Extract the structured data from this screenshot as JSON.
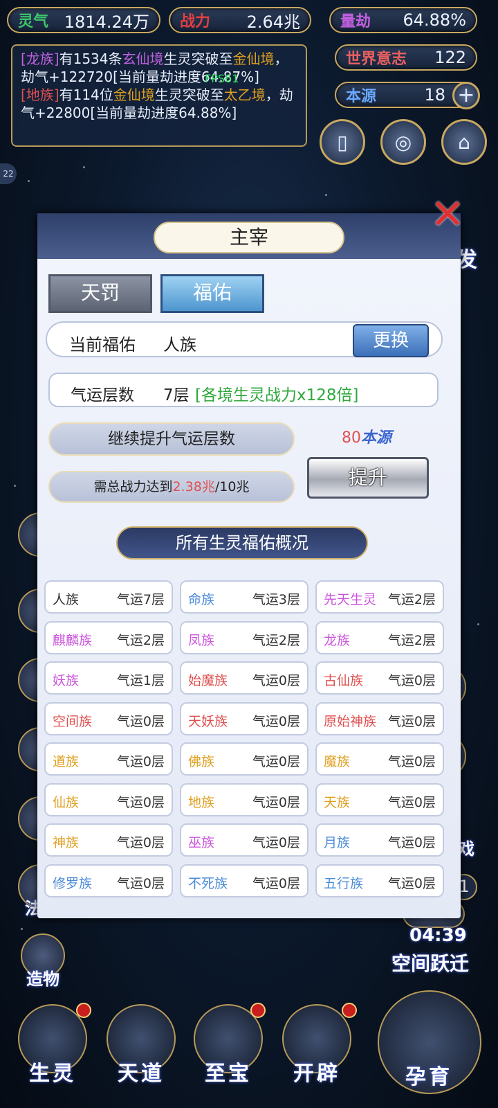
{
  "colors": {
    "purple": "#cc55dd",
    "gold": "#e0a020",
    "red": "#e05050",
    "blue": "#4a8ad8",
    "gray": "#333333",
    "green": "#2ea83a"
  },
  "top": {
    "lingqi": {
      "label": "灵气",
      "value": "1814.24万"
    },
    "zhanli": {
      "label": "战力",
      "value": "2.64兆"
    },
    "liangjie": {
      "label": "量劫",
      "value": "64.88%"
    },
    "shijie": {
      "label": "世界意志",
      "value": "122"
    },
    "benyuan": {
      "label": "本源",
      "value": "18"
    }
  },
  "fps": "FPS61",
  "log": [
    {
      "tag": "[龙族]",
      "a": "有1534条",
      "realm": "玄仙境",
      "b": "生灵突破至",
      "realm2": "金仙境",
      "c": "，劫气+122720[当前量劫进度64.87%]"
    },
    {
      "tag": "[地族]",
      "a": "有114位",
      "realm": "金仙境",
      "b": "生灵突破至",
      "realm2": "太乙境",
      "c": "，劫气+22800[当前量劫进度64.88%]"
    }
  ],
  "side": {
    "badge": "22",
    "left_labels": [
      "法则",
      "造物"
    ],
    "right_labels": [
      "发",
      "戏"
    ],
    "right_count": "1",
    "timer": "04:39",
    "kongjian": "空间跃迁"
  },
  "bottom": [
    "生灵",
    "天道",
    "至宝",
    "开辟",
    "孕育"
  ],
  "modal": {
    "title": "主宰",
    "tabs": [
      "天罚",
      "福佑"
    ],
    "current_label": "当前福佑",
    "current_value": "人族",
    "change": "更换",
    "qiyun_label": "气运层数",
    "qiyun_value": "7层",
    "qiyun_bonus": "[各境生灵战力x128倍]",
    "continue": "继续提升气运层数",
    "cost_num": "80",
    "cost_unit": "本源",
    "need_prefix": "需总战力达到",
    "need_value": "2.38兆",
    "need_suffix": "/10兆",
    "upgrade": "提升",
    "banner": "所有生灵福佑概况"
  },
  "grid": [
    {
      "name": "人族",
      "level": "气运7层",
      "color": "#333333"
    },
    {
      "name": "命族",
      "level": "气运3层",
      "color": "#4a8ad8"
    },
    {
      "name": "先天生灵",
      "level": "气运2层",
      "color": "#cc55dd"
    },
    {
      "name": "麒麟族",
      "level": "气运2层",
      "color": "#cc55dd"
    },
    {
      "name": "凤族",
      "level": "气运2层",
      "color": "#cc55dd"
    },
    {
      "name": "龙族",
      "level": "气运2层",
      "color": "#cc55dd"
    },
    {
      "name": "妖族",
      "level": "气运1层",
      "color": "#cc55dd"
    },
    {
      "name": "始魔族",
      "level": "气运0层",
      "color": "#e05050"
    },
    {
      "name": "古仙族",
      "level": "气运0层",
      "color": "#e05050"
    },
    {
      "name": "空间族",
      "level": "气运0层",
      "color": "#e05050"
    },
    {
      "name": "天妖族",
      "level": "气运0层",
      "color": "#e05050"
    },
    {
      "name": "原始神族",
      "level": "气运0层",
      "color": "#e05050"
    },
    {
      "name": "道族",
      "level": "气运0层",
      "color": "#e0a020"
    },
    {
      "name": "佛族",
      "level": "气运0层",
      "color": "#e0a020"
    },
    {
      "name": "魔族",
      "level": "气运0层",
      "color": "#e0a020"
    },
    {
      "name": "仙族",
      "level": "气运0层",
      "color": "#e0a020"
    },
    {
      "name": "地族",
      "level": "气运0层",
      "color": "#e0a020"
    },
    {
      "name": "天族",
      "level": "气运0层",
      "color": "#e0a020"
    },
    {
      "name": "神族",
      "level": "气运0层",
      "color": "#e0a020"
    },
    {
      "name": "巫族",
      "level": "气运0层",
      "color": "#cc55dd"
    },
    {
      "name": "月族",
      "level": "气运0层",
      "color": "#4a8ad8"
    },
    {
      "name": "修罗族",
      "level": "气运0层",
      "color": "#4a8ad8"
    },
    {
      "name": "不死族",
      "level": "气运0层",
      "color": "#4a8ad8"
    },
    {
      "name": "五行族",
      "level": "气运0层",
      "color": "#4a8ad8"
    }
  ]
}
